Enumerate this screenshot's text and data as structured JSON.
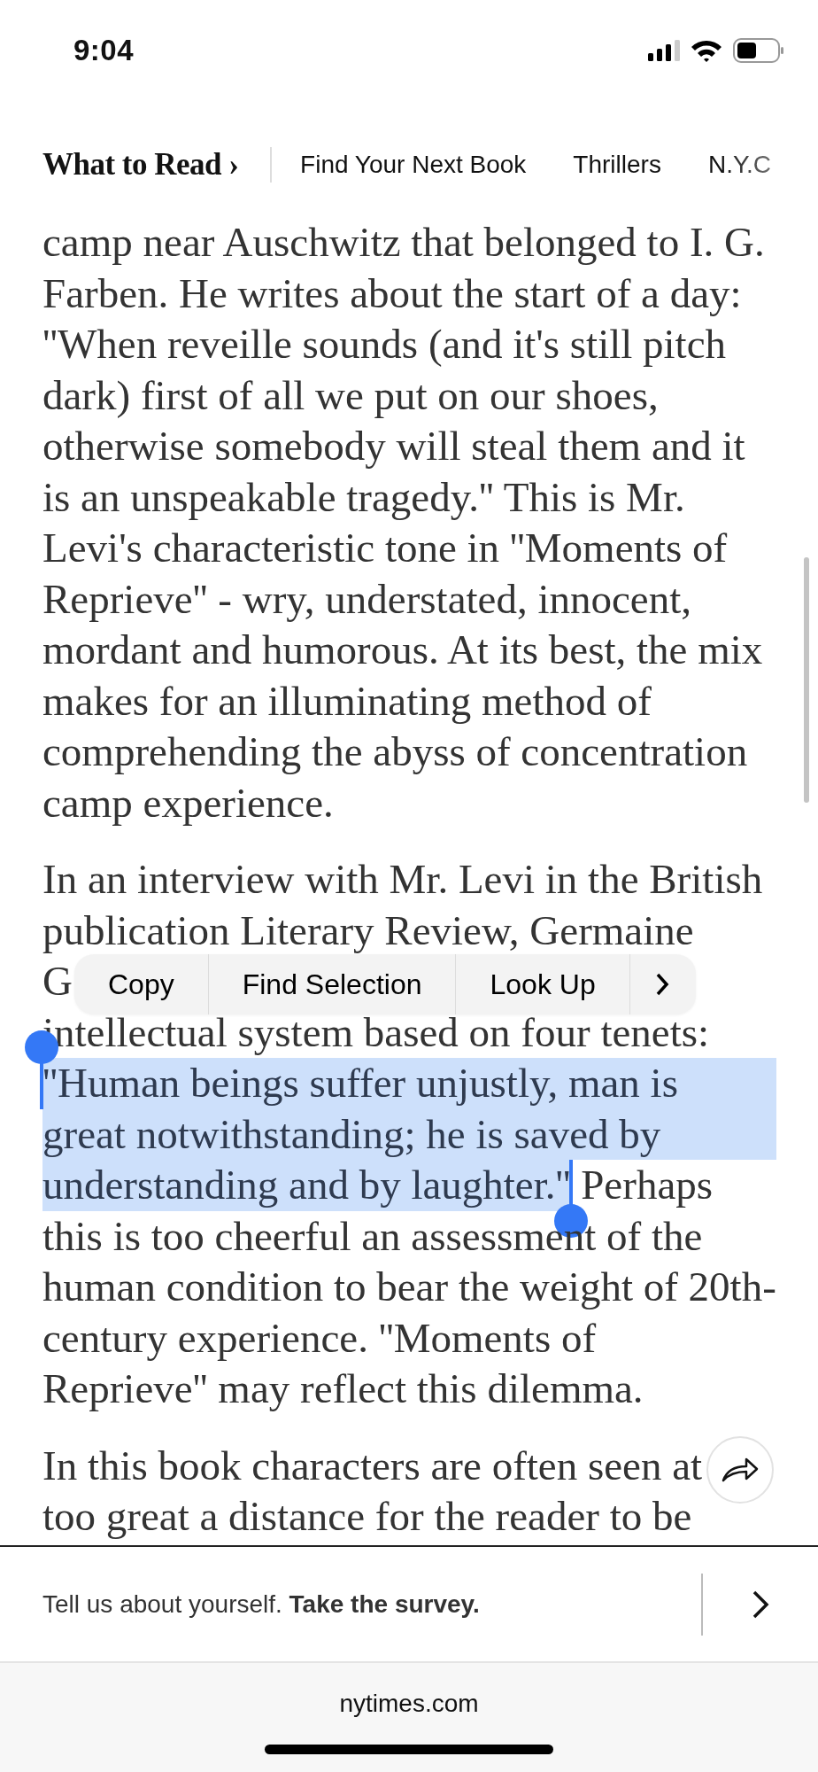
{
  "status_bar": {
    "time": "9:04"
  },
  "nav": {
    "title": "What to Read ›",
    "links": [
      "Find Your Next Book",
      "Thrillers",
      "N.Y.C"
    ]
  },
  "article": {
    "paragraphs": [
      {
        "lines": [
          {
            "segments": [
              {
                "text": "camp near Auschwitz that belonged to I. G.",
                "selected": false
              }
            ]
          },
          {
            "segments": [
              {
                "text": "Farben. He writes about the start of a day:",
                "selected": false
              }
            ]
          },
          {
            "segments": [
              {
                "text": "''When reveille sounds (and it's still pitch",
                "selected": false
              }
            ]
          },
          {
            "segments": [
              {
                "text": "dark) first of all we put on our shoes,",
                "selected": false
              }
            ]
          },
          {
            "segments": [
              {
                "text": "otherwise somebody will steal them and it",
                "selected": false
              }
            ]
          },
          {
            "segments": [
              {
                "text": "is an unspeakable tragedy.'' This is Mr.",
                "selected": false
              }
            ]
          },
          {
            "segments": [
              {
                "text": "Levi's characteristic tone in ''Moments of",
                "selected": false
              }
            ]
          },
          {
            "segments": [
              {
                "text": "Reprieve'' - wry, understated, innocent,",
                "selected": false
              }
            ]
          },
          {
            "segments": [
              {
                "text": "mordant and humorous. At its best, the mix",
                "selected": false
              }
            ]
          },
          {
            "segments": [
              {
                "text": "makes for an illuminating method of",
                "selected": false
              }
            ]
          },
          {
            "segments": [
              {
                "text": "comprehending the abyss of concentration",
                "selected": false
              }
            ]
          },
          {
            "segments": [
              {
                "text": "camp experience.",
                "selected": false
              }
            ]
          }
        ]
      },
      {
        "lines": [
          {
            "segments": [
              {
                "text": "In an interview with Mr. Levi in the British",
                "selected": false
              }
            ]
          },
          {
            "segments": [
              {
                "text": "publication Literary Review, Germaine",
                "selected": false
              }
            ]
          },
          {
            "segments": [
              {
                "text": "G",
                "selected": false
              }
            ]
          },
          {
            "segments": [
              {
                "text": "intellectual system based on four tenets:",
                "selected": false
              }
            ]
          },
          {
            "segments": [
              {
                "text": "''Human beings suffer unjustly, man is",
                "selected": true
              }
            ]
          },
          {
            "segments": [
              {
                "text": "great notwithstanding; he is saved by",
                "selected": true
              }
            ]
          },
          {
            "segments": [
              {
                "text": "understanding and by laughter.''",
                "selected": true
              },
              {
                "text": " Perhaps",
                "selected": false
              }
            ]
          },
          {
            "segments": [
              {
                "text": "this is too cheerful an assessment of the",
                "selected": false
              }
            ]
          },
          {
            "segments": [
              {
                "text": "human condition to bear the weight of 20th-",
                "selected": false
              }
            ]
          },
          {
            "segments": [
              {
                "text": "century experience. ''Moments of",
                "selected": false
              }
            ]
          },
          {
            "segments": [
              {
                "text": "Reprieve'' may reflect this dilemma.",
                "selected": false
              }
            ]
          }
        ]
      },
      {
        "lines": [
          {
            "segments": [
              {
                "text": "In this book characters are often seen at",
                "selected": false
              }
            ]
          },
          {
            "segments": [
              {
                "text": "too great a distance for the reader to be",
                "selected": false
              }
            ]
          }
        ]
      }
    ]
  },
  "context_menu": {
    "items": [
      "Copy",
      "Find Selection",
      "Look Up"
    ]
  },
  "survey_banner": {
    "text": "Tell us about yourself. **Take the survey.**"
  },
  "address_bar": {
    "domain": "nytimes.com"
  }
}
